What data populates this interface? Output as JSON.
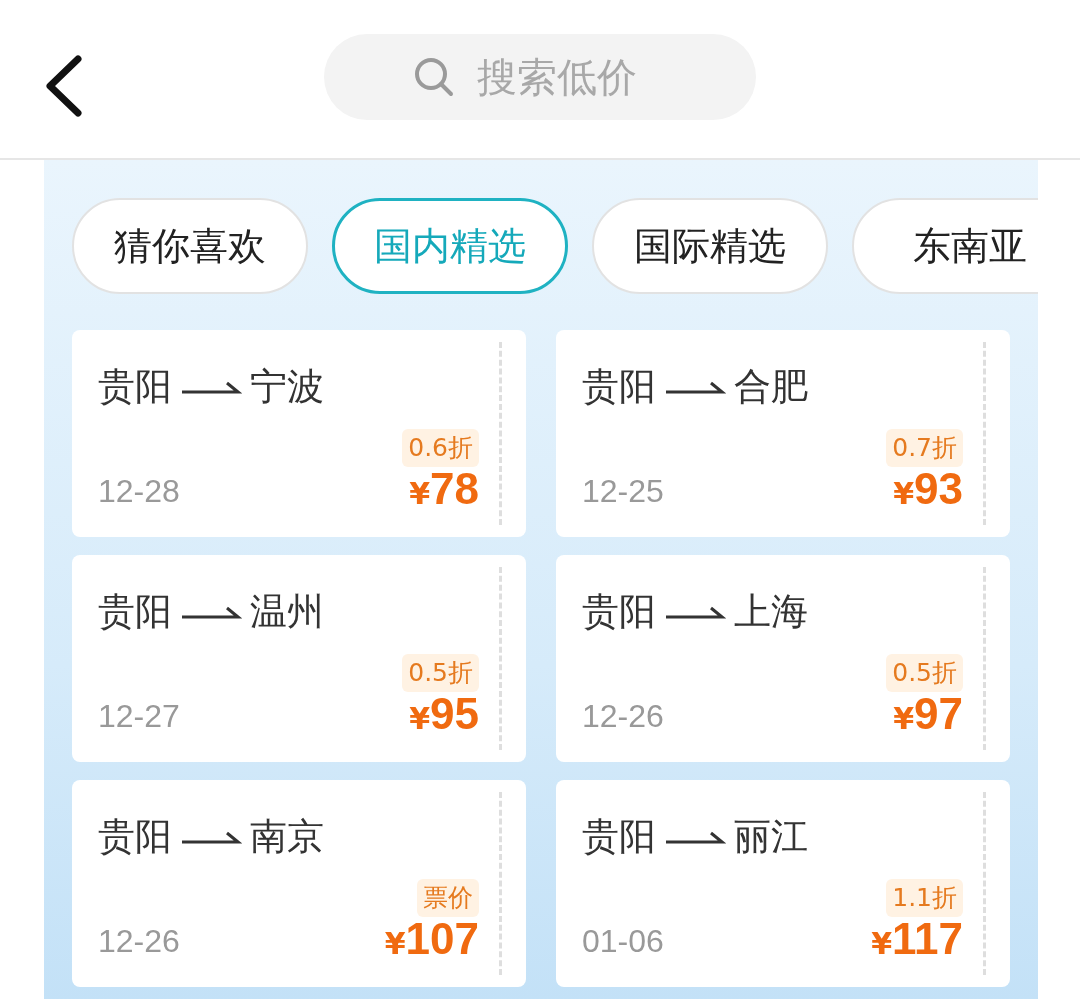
{
  "header": {
    "search": {
      "placeholder": "搜索低价"
    }
  },
  "tabs": [
    {
      "label": "猜你喜欢",
      "selected": false
    },
    {
      "label": "国内精选",
      "selected": true
    },
    {
      "label": "国际精选",
      "selected": false
    },
    {
      "label": "东南亚",
      "selected": false
    }
  ],
  "deals": [
    {
      "from": "贵阳",
      "to": "宁波",
      "date": "12-28",
      "badge": "0.6折",
      "currency": "¥",
      "price": "78"
    },
    {
      "from": "贵阳",
      "to": "合肥",
      "date": "12-25",
      "badge": "0.7折",
      "currency": "¥",
      "price": "93"
    },
    {
      "from": "贵阳",
      "to": "温州",
      "date": "12-27",
      "badge": "0.5折",
      "currency": "¥",
      "price": "95"
    },
    {
      "from": "贵阳",
      "to": "上海",
      "date": "12-26",
      "badge": "0.5折",
      "currency": "¥",
      "price": "97"
    },
    {
      "from": "贵阳",
      "to": "南京",
      "date": "12-26",
      "badge": "票价",
      "currency": "¥",
      "price": "107"
    },
    {
      "from": "贵阳",
      "to": "丽江",
      "date": "01-06",
      "badge": "1.1折",
      "currency": "¥",
      "price": "117"
    }
  ]
}
